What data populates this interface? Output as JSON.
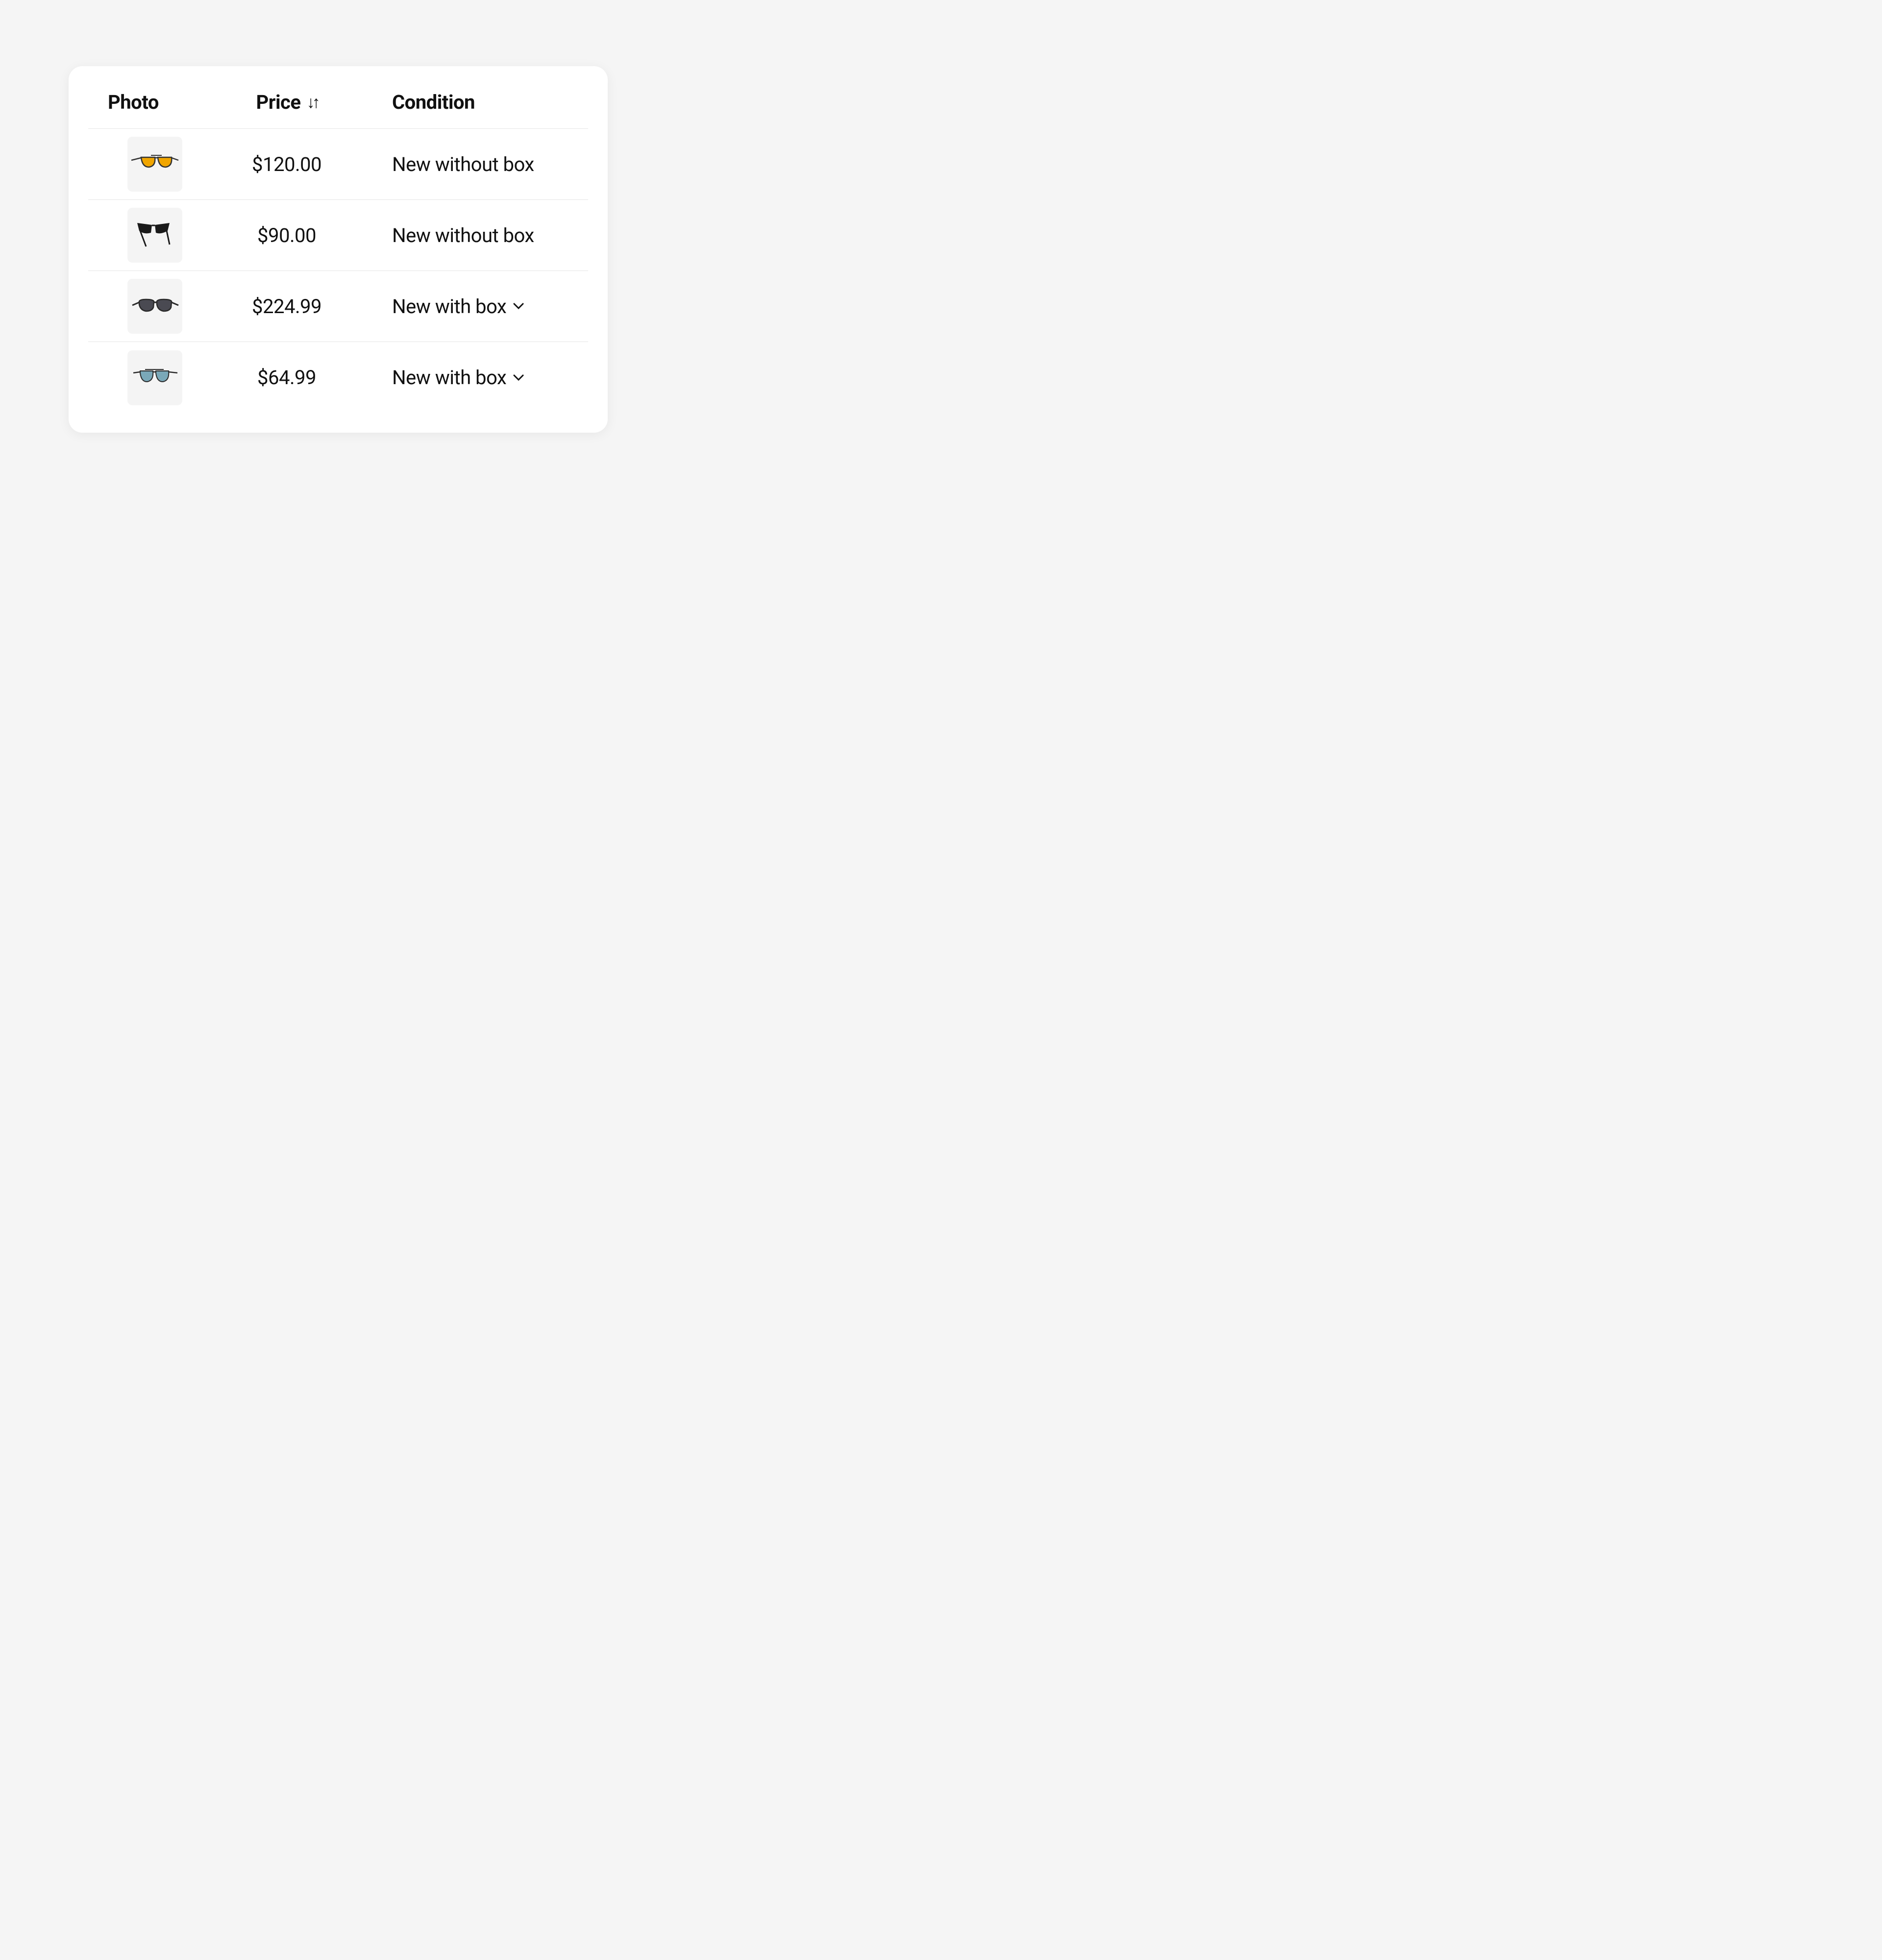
{
  "table": {
    "headers": {
      "photo": "Photo",
      "price": "Price",
      "condition": "Condition"
    },
    "rows": [
      {
        "price": "$120.00",
        "condition": "New without box",
        "has_chevron": false,
        "thumb": "aviator-yellow"
      },
      {
        "price": "$90.00",
        "condition": "New without box",
        "has_chevron": false,
        "thumb": "sport-black"
      },
      {
        "price": "$224.99",
        "condition": "New with box",
        "has_chevron": true,
        "thumb": "wayfarer-grey"
      },
      {
        "price": "$64.99",
        "condition": "New with box",
        "has_chevron": true,
        "thumb": "aviator-blue"
      }
    ]
  }
}
